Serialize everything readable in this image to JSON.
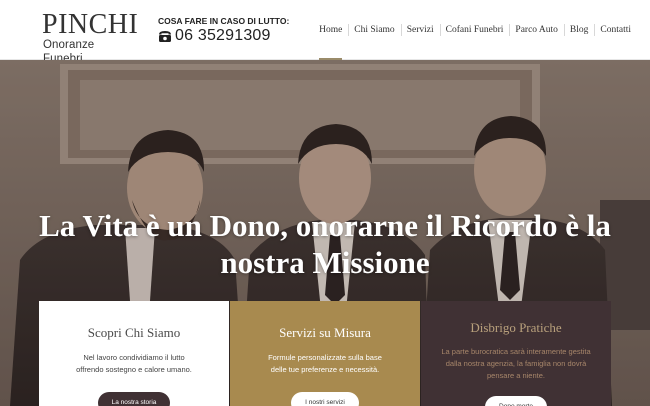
{
  "brand": {
    "name": "PINCHI",
    "tagline": "Onoranze Funebri"
  },
  "emergency": {
    "label": "COSA FARE IN CASO DI LUTTO:",
    "phone": "06 35291309"
  },
  "nav": {
    "items": [
      {
        "label": "Home",
        "active": true
      },
      {
        "label": "Chi Siamo",
        "active": false
      },
      {
        "label": "Servizi",
        "active": false
      },
      {
        "label": "Cofani Funebri",
        "active": false
      },
      {
        "label": "Parco Auto",
        "active": false
      },
      {
        "label": "Blog",
        "active": false
      },
      {
        "label": "Contatti",
        "active": false
      }
    ]
  },
  "hero": {
    "title_line1": "La Vita è un Dono, onorarne il Ricordo è la",
    "title_line2": "nostra Missione"
  },
  "cards": [
    {
      "title": "Scopri Chi Siamo",
      "text_line1": "Nel lavoro condividiamo il lutto",
      "text_line2": "offrendo sostegno e calore umano.",
      "button": "La nostra storia"
    },
    {
      "title": "Servizi su Misura",
      "text_line1": "Formule personalizzate sulla base",
      "text_line2": "delle tue preferenze e necessità.",
      "button": "I nostri servizi"
    },
    {
      "title": "Disbrigo Pratiche",
      "text_line1": "La parte burocratica sarà interamente gestita",
      "text_line2": "dalla nostra agenzia, la famiglia non dovrà",
      "text_line3": "pensare a niente.",
      "button": "Dopo morte"
    }
  ],
  "colors": {
    "accent_gold": "#a88a4f",
    "dark_plum": "#403134",
    "hero_tone": "#7a6b62"
  },
  "icons": {
    "phone": "phone-icon"
  }
}
